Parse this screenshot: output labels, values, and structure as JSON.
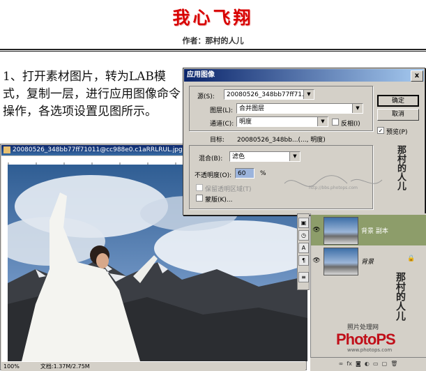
{
  "header": {
    "title": "我心飞翔",
    "author": "作者：那村的人儿"
  },
  "instructions": "1、打开素材图片，转为LAB模式，复制一层，进行应用图像命令操作，各选项设置见图所示。",
  "document": {
    "title": "20080526_348bb77ff71011@cc988e0.c1aRRLRUL.jpg @",
    "zoom": "100%",
    "doc_size": "文档:1.37M/2.75M"
  },
  "dialog": {
    "title": "应用图像",
    "source_label": "源(S):",
    "source_value": "20080526_348bb77ff71...",
    "layer_label": "图层(L):",
    "layer_value": "合并图层",
    "channel_label": "通道(C):",
    "channel_value": "明度",
    "invert_label": "反相(I)",
    "target_label": "目标:",
    "target_value": "20080526_348bb...(..., 明度)",
    "blend_label": "混合(B):",
    "blend_value": "滤色",
    "opacity_label": "不透明度(O):",
    "opacity_value": "60",
    "opacity_unit": "%",
    "preserve_label": "保留透明区域(T)",
    "mask_label": "蒙版(K)...",
    "ok_label": "确定",
    "cancel_label": "取消",
    "preview_label": "预览(P)",
    "close_label": "x"
  },
  "layers": {
    "items": [
      {
        "name": "背景 副本"
      },
      {
        "name": "背景"
      }
    ],
    "brand_caption": "照片处理网",
    "brand_logo": "PhotoPS",
    "brand_url": "www.photops.com"
  },
  "watermark": {
    "signature": "那村的人儿",
    "site": "http://bbs.photops.com"
  },
  "colors": {
    "title_red": "#d80000",
    "titlebar_blue": "#0a246a",
    "dialog_grey": "#d4d0c8",
    "layer_selected": "#8d9d6a"
  }
}
